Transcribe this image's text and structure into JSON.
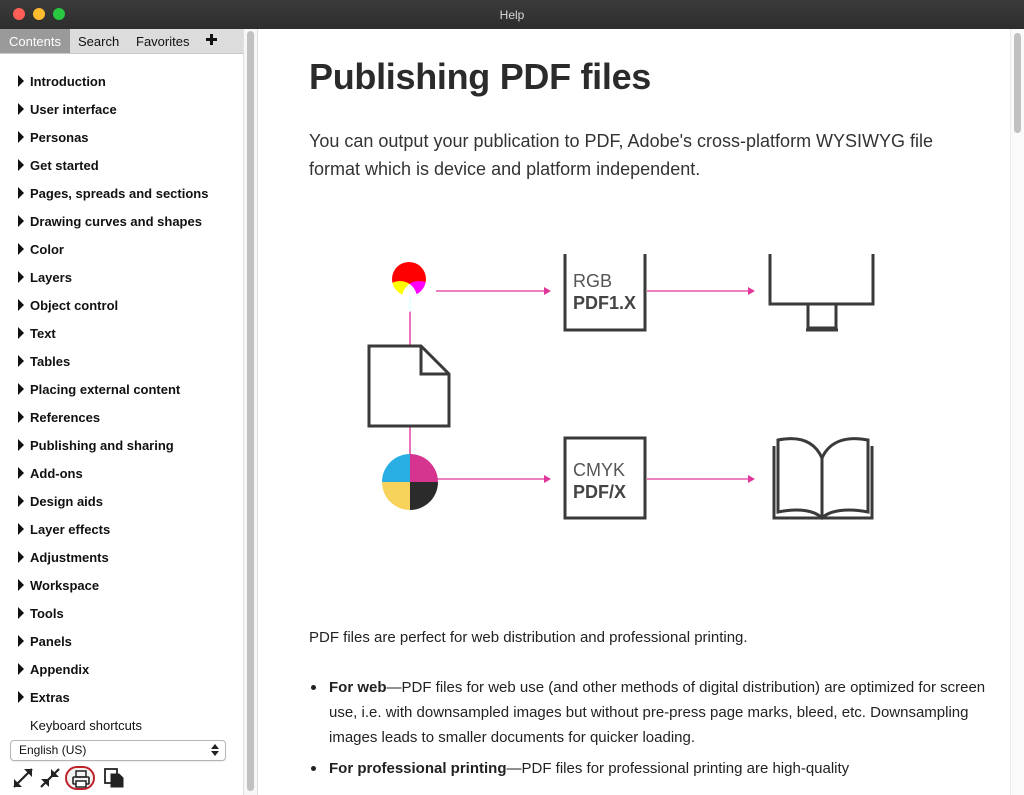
{
  "window": {
    "title": "Help"
  },
  "sidebar": {
    "tabs": [
      {
        "label": "Contents"
      },
      {
        "label": "Search"
      },
      {
        "label": "Favorites"
      }
    ],
    "toc": [
      {
        "label": "Introduction"
      },
      {
        "label": "User interface"
      },
      {
        "label": "Personas"
      },
      {
        "label": "Get started"
      },
      {
        "label": "Pages, spreads and sections"
      },
      {
        "label": "Drawing curves and shapes"
      },
      {
        "label": "Color"
      },
      {
        "label": "Layers"
      },
      {
        "label": "Object control"
      },
      {
        "label": "Text"
      },
      {
        "label": "Tables"
      },
      {
        "label": "Placing external content"
      },
      {
        "label": "References"
      },
      {
        "label": "Publishing and sharing"
      },
      {
        "label": "Add-ons"
      },
      {
        "label": "Design aids"
      },
      {
        "label": "Layer effects"
      },
      {
        "label": "Adjustments"
      },
      {
        "label": "Workspace"
      },
      {
        "label": "Tools"
      },
      {
        "label": "Panels"
      },
      {
        "label": "Appendix"
      },
      {
        "label": "Extras"
      }
    ],
    "toc_plain": {
      "label": "Keyboard shortcuts"
    },
    "language": {
      "value": "English (US)"
    },
    "toolbar_icons": [
      "expand-icon",
      "collapse-icon",
      "print-icon",
      "copy-icon"
    ]
  },
  "content": {
    "title": "Publishing PDF files",
    "intro": "You can output your publication to PDF, Adobe's cross-platform WYSIWYG file format which is device and platform independent.",
    "diagram": {
      "top_box": {
        "line1": "RGB",
        "line2": "PDF1.X"
      },
      "bottom_box": {
        "line1": "CMYK",
        "line2": "PDF/X"
      },
      "arrow_color": "#e0359a"
    },
    "para": "PDF files are perfect for web distribution and professional printing.",
    "bullets": [
      {
        "bold": "For web",
        "text": "—PDF files for web use (and other methods of digital distribution) are optimized for screen use, i.e. with downsampled images but without pre-press page marks, bleed, etc. Downsampling images leads to smaller documents for quicker loading."
      },
      {
        "bold": "For professional printing",
        "text": "—PDF files for professional printing are high-quality"
      }
    ]
  }
}
